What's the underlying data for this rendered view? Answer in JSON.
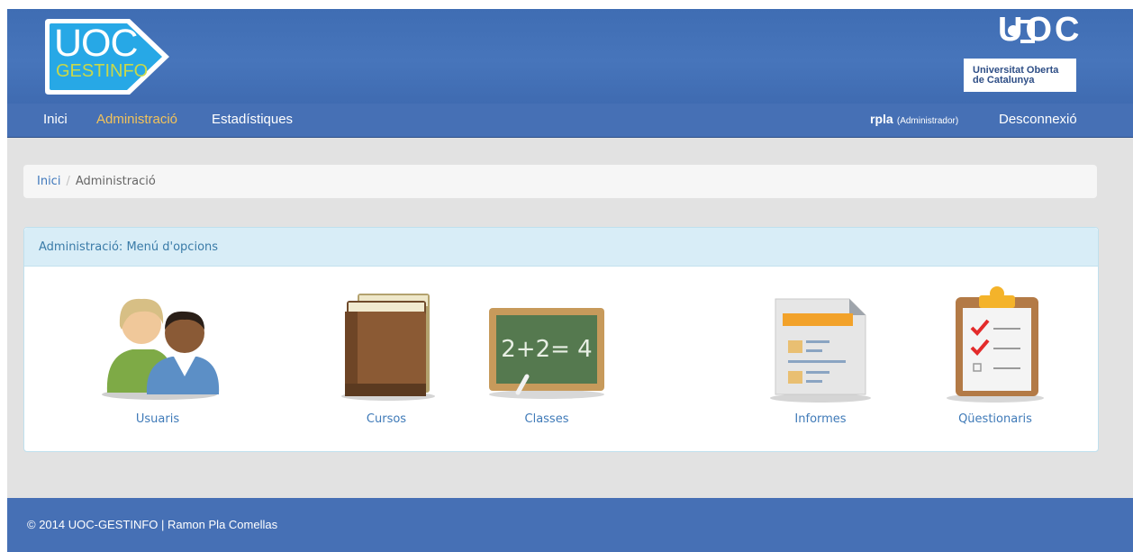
{
  "header": {
    "logo_line1": "UOC",
    "logo_line2": "GESTINFO",
    "university_short": "UOC",
    "university_line1": "Universitat Oberta",
    "university_line2": "de Catalunya"
  },
  "nav": {
    "items": [
      {
        "label": "Inici",
        "active": false
      },
      {
        "label": "Administració",
        "active": true
      },
      {
        "label": "Estadístiques",
        "active": false
      }
    ],
    "user_name": "rpla",
    "user_role": "(Administrador)",
    "logout_label": "Desconnexió"
  },
  "breadcrumb": {
    "home": "Inici",
    "separator": "/",
    "current": "Administració"
  },
  "panel": {
    "title": "Administració: Menú d'opcions",
    "options": [
      {
        "label": "Usuaris",
        "icon": "users-icon"
      },
      {
        "label": "Cursos",
        "icon": "books-icon"
      },
      {
        "label": "Classes",
        "icon": "chalkboard-icon"
      },
      {
        "label": "Informes",
        "icon": "report-document-icon"
      },
      {
        "label": "Qüestionaris",
        "icon": "clipboard-checklist-icon"
      }
    ],
    "chalkboard_text": "2+2= 4"
  },
  "footer": {
    "text": "© 2014 UOC-GESTINFO | Ramon Pla Comellas"
  },
  "colors": {
    "header_blue": "#4670b5",
    "nav_active": "#f3c35a",
    "link_blue": "#3f78bc",
    "panel_heading_bg": "#d8edf7",
    "logo_cyan": "#27a8e6",
    "logo_lime": "#c8d84a"
  }
}
